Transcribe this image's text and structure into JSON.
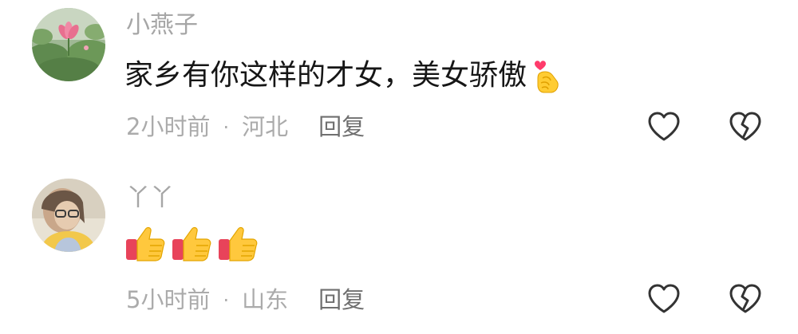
{
  "comments": [
    {
      "username": "小燕子",
      "avatar_icon": "lotus-avatar",
      "text": "家乡有你这样的才女，美女骄傲",
      "emoji": "heart-hands-icon",
      "meta": {
        "time": "2小时前",
        "separator": "·",
        "location": "河北",
        "reply_label": "回复"
      },
      "actions": {
        "like_icon": "heart-outline-icon",
        "dislike_icon": "broken-heart-outline-icon"
      }
    },
    {
      "username": "丫丫",
      "avatar_icon": "portrait-avatar",
      "emoji": "thumbs-up-icon",
      "emoji_count": 3,
      "meta": {
        "time": "5小时前",
        "separator": "·",
        "location": "山东",
        "reply_label": "回复"
      },
      "actions": {
        "like_icon": "heart-outline-icon",
        "dislike_icon": "broken-heart-outline-icon"
      }
    }
  ],
  "colors": {
    "username": "#a6a6a6",
    "body_text": "#161616",
    "meta": "#ababab",
    "reply": "#6f6f6f",
    "icon_stroke": "#333333"
  }
}
